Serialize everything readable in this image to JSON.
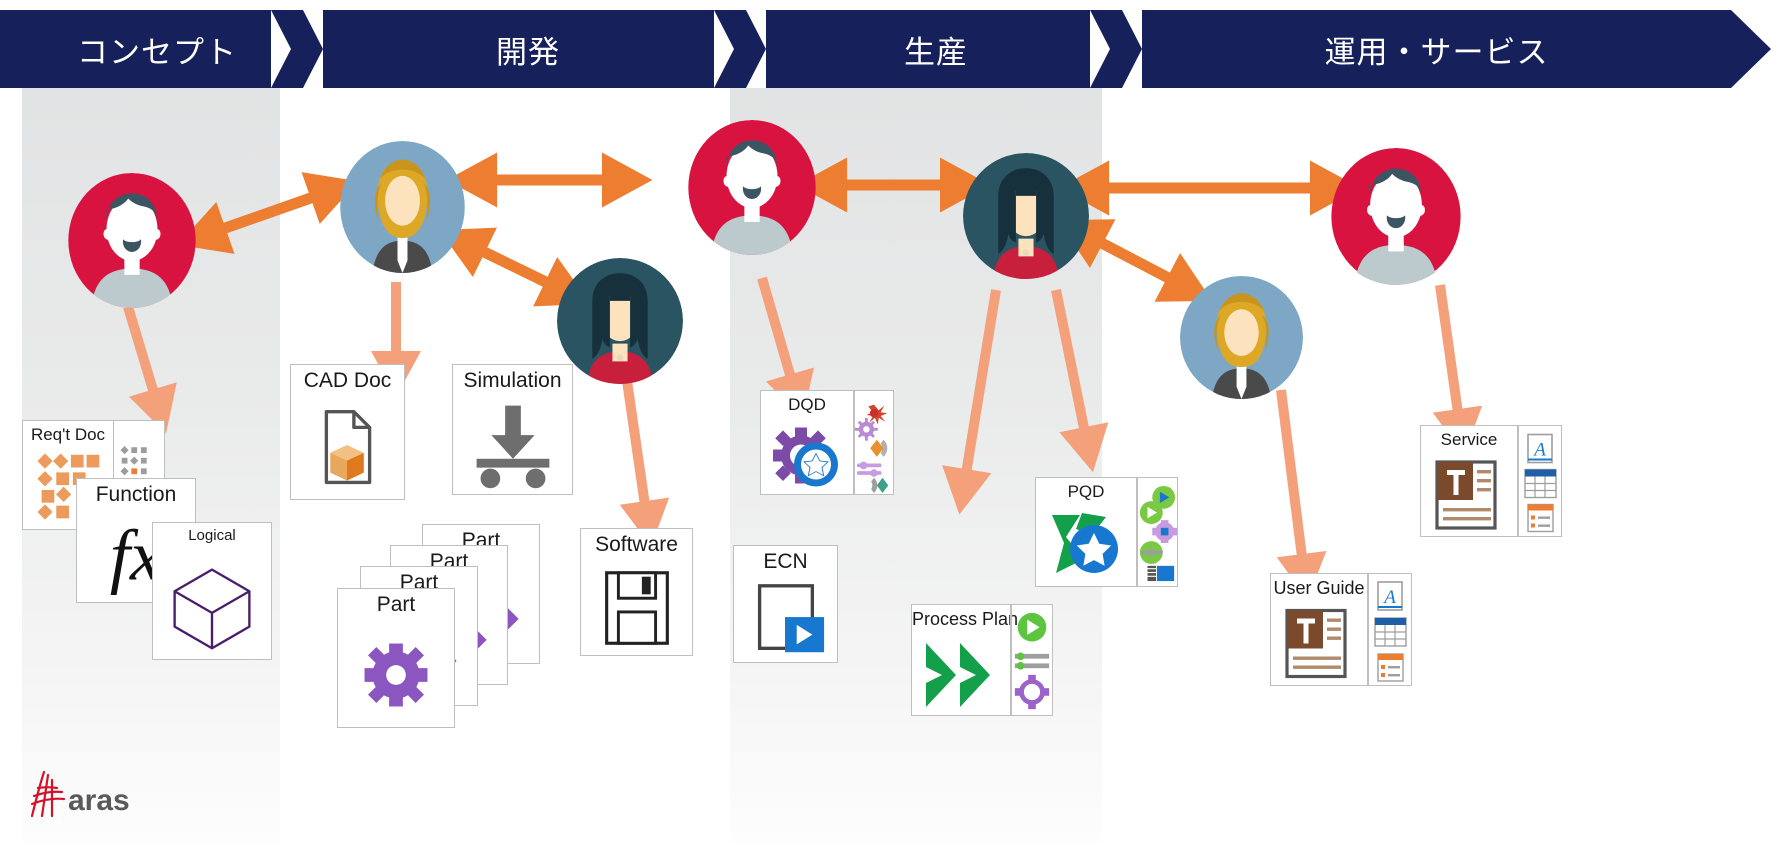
{
  "header": {
    "stages": [
      {
        "label": "コンセプト",
        "name": "stage-concept"
      },
      {
        "label": "開発",
        "name": "stage-development"
      },
      {
        "label": "生産",
        "name": "stage-production"
      },
      {
        "label": "運用・サービス",
        "name": "stage-operation-service"
      }
    ],
    "bar_color": "#16205a",
    "text_color": "#ffffff"
  },
  "colors": {
    "navy": "#16205a",
    "arrow_strong": "#ED7D31",
    "arrow_light": "#F4A07A",
    "avatar_red": "#D8133F",
    "avatar_blue": "#7DA7C4",
    "avatar_teal": "#2B5463",
    "card_border": "#bfbfbf",
    "purple": "#7C4BA8",
    "green": "#14A04B",
    "blue": "#1878CF",
    "brown": "#7B4A2D",
    "orange": "#ED7D31",
    "logo_red": "#D3122A",
    "logo_text": "#5a5a5a"
  },
  "personas": [
    {
      "name": "persona-concept-engineer",
      "style": "man-beard",
      "bg": "#D8133F"
    },
    {
      "name": "persona-design-engineer",
      "style": "woman-blonde",
      "bg": "#7DA7C4"
    },
    {
      "name": "persona-simulation-engineer",
      "style": "woman-dark",
      "bg": "#2B5463"
    },
    {
      "name": "persona-manufacturing-engineer",
      "style": "man-beard",
      "bg": "#D8133F"
    },
    {
      "name": "persona-production-planner",
      "style": "woman-dark",
      "bg": "#2B5463"
    },
    {
      "name": "persona-service-technician",
      "style": "woman-blonde",
      "bg": "#7DA7C4"
    },
    {
      "name": "persona-service-manager",
      "style": "man-beard",
      "bg": "#D8133F"
    }
  ],
  "artifacts": {
    "reqt_doc": {
      "label": "Req't Doc",
      "icon": "requirements-matrix-icon"
    },
    "reqt_doc_back": {
      "label": "",
      "icon": "requirements-matrix-small-icon"
    },
    "function": {
      "label": "Function",
      "icon": "fx-formula-icon"
    },
    "logical": {
      "label": "Logical",
      "icon": "logical-cube-icon"
    },
    "cad_doc": {
      "label": "CAD Doc",
      "icon": "cad-document-icon"
    },
    "simulation": {
      "label": "Simulation",
      "icon": "simulation-load-icon"
    },
    "part": {
      "label": "Part",
      "icon": "part-gear-icon",
      "stack_count": 4
    },
    "software": {
      "label": "Software",
      "icon": "floppy-disk-icon"
    },
    "dqd": {
      "label": "DQD",
      "icon": "gear-star-icon"
    },
    "ecn": {
      "label": "ECN",
      "icon": "document-play-icon"
    },
    "process_plan": {
      "label": "Process Plan",
      "icon": "green-chevrons-icon"
    },
    "pqd": {
      "label": "PQD",
      "icon": "green-flow-star-icon"
    },
    "user_guide": {
      "label": "User Guide",
      "icon": "text-document-icon"
    },
    "service": {
      "label": "Service",
      "icon": "text-document-icon"
    }
  },
  "logo": {
    "text": "aras",
    "name": "aras-logo"
  }
}
